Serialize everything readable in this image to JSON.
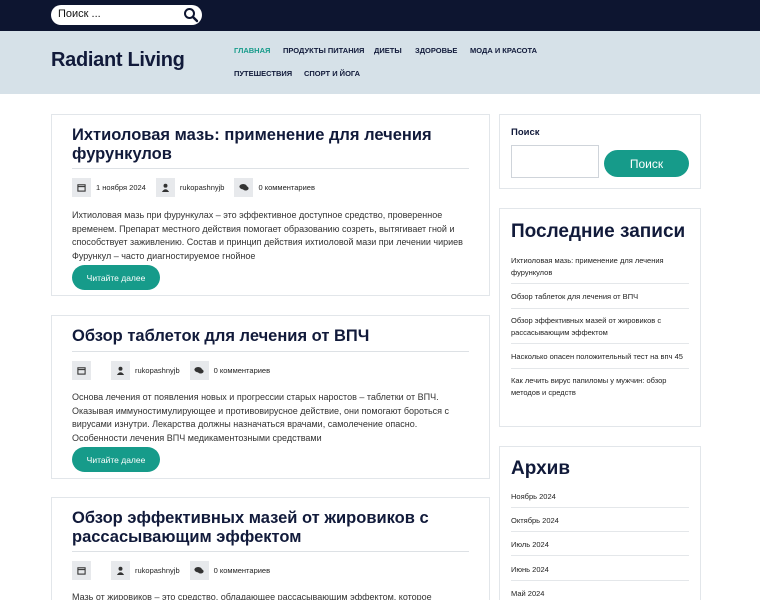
{
  "top_search": {
    "placeholder": "Поиск ..."
  },
  "site": {
    "title": "Radiant Living"
  },
  "nav": [
    "Главная",
    "Продукты питания",
    "Диеты",
    "Здоровье",
    "Мода и красота",
    "Путешествия",
    "Спорт и йога"
  ],
  "posts": [
    {
      "title": "Ихтиоловая мазь: применение для лечения фурункулов",
      "date": "1 ноября 2024",
      "author": "rukopashnyjb",
      "comments": "0 комментариев",
      "excerpt": "Ихтиоловая мазь при фурункулах – это эффективное доступное средство, проверенное временем. Препарат местного действия помогает образованию созреть, вытягивает гной и способствует заживлению. Состав и принцип действия ихтиоловой мази при лечении чириев Фурункул – часто диагностируемое гнойное",
      "read_more": "Читайте далее"
    },
    {
      "title": "Обзор таблеток для лечения от ВПЧ",
      "author": "rukopashnyjb",
      "comments": "0 комментариев",
      "excerpt": "Основа лечения от появления новых и прогрессии старых наростов – таблетки от ВПЧ. Оказывая иммуностимулирующее и противовирусное действие, они помогают бороться с вирусами изнутри. Лекарства должны назначаться врачами, самолечение опасно. Особенности лечения ВПЧ медикаментозными средствами",
      "read_more": "Читайте далее"
    },
    {
      "title": "Обзор эффективных мазей от жировиков с рассасывающим эффектом",
      "author": "rukopashnyjb",
      "comments": "0 комментариев",
      "excerpt": "Мазь от жировиков – это средство, обладающее рассасывающим эффектом, которое помогает"
    }
  ],
  "sidebar": {
    "search": {
      "label": "Поиск",
      "button": "Поиск"
    },
    "recent": {
      "title": "Последние записи",
      "items": [
        "Ихтиоловая мазь: применение для лечения фурункулов",
        "Обзор таблеток для лечения от ВПЧ",
        "Обзор эффективных мазей от жировиков с рассасывающим эффектом",
        "Насколько опасен положительный тест на впч 45",
        "Как лечить вирус папиломы у мужчин: обзор методов и средств"
      ]
    },
    "archive": {
      "title": "Архив",
      "items": [
        "Ноябрь 2024",
        "Октябрь 2024",
        "Июль 2024",
        "Июнь 2024",
        "Май 2024"
      ]
    }
  },
  "colors": {
    "accent": "#169b8a",
    "topbar": "#0d1530",
    "header": "#d6e1e8",
    "text": "#111a3a"
  }
}
